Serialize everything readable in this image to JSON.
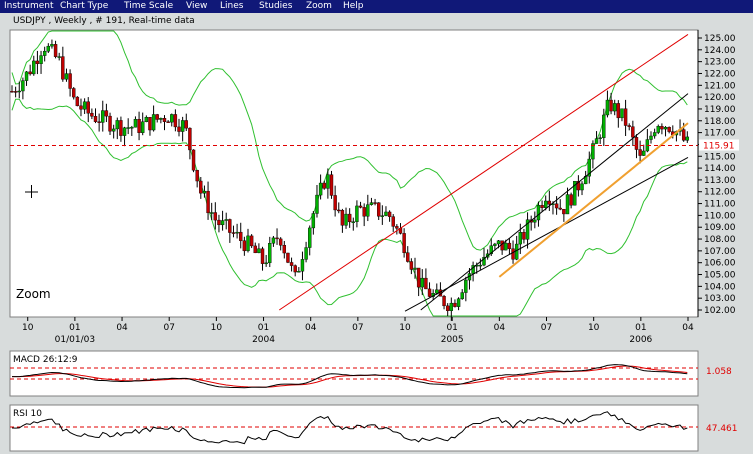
{
  "menu": {
    "items": [
      "Instrument",
      "Chart Type",
      "Time Scale",
      "View",
      "Lines",
      "Studies",
      "Zoom",
      "Help"
    ]
  },
  "main_chart": {
    "title": "USDJPY , Weekly , # 191, Real-time data",
    "zoom_label": "Zoom",
    "y_tick_labels": [
      "125.00",
      "124.00",
      "123.00",
      "122.00",
      "121.00",
      "120.00",
      "119.00",
      "118.00",
      "117.00",
      "116.00",
      "115.00",
      "114.00",
      "113.00",
      "112.00",
      "111.00",
      "110.00",
      "109.00",
      "108.00",
      "107.00",
      "106.00",
      "105.00",
      "104.00",
      "103.00",
      "102.00"
    ],
    "current_price_label": "115.91",
    "x_month_labels": [
      "10",
      "01",
      "04",
      "07",
      "10",
      "01",
      "04",
      "07",
      "10",
      "01",
      "04",
      "07",
      "10",
      "01",
      "04"
    ],
    "x_year_labels": [
      "01/01/03",
      "2004",
      "2005",
      "2006"
    ]
  },
  "macd_panel": {
    "title": "MACD 26:12:9",
    "value_label": "1.058"
  },
  "rsi_panel": {
    "title": "RSI 10",
    "value_label": "47.461"
  },
  "colors": {
    "menubar_bg": "#101878",
    "frame_bg": "#d8dcdc",
    "panel_bg": "#ffffff",
    "candle_up": "#00b000",
    "candle_down": "#c00000",
    "bollinger": "#30c030",
    "trendline_red": "#e00000",
    "trendline_black": "#000000",
    "trendline_orange": "#f0a030",
    "dashed_level": "#e00000"
  },
  "chart_data": {
    "type": "candlestick",
    "title": "USDJPY , Weekly , # 191, Real-time data",
    "timeframe": "Weekly",
    "x_range": [
      "2002-09",
      "2006-04"
    ],
    "ylim": [
      102.0,
      125.5
    ],
    "y_tick_step": 1.0,
    "current_price": 115.91,
    "price_path_monthly": [
      {
        "date": "2002-09",
        "close": 120.5
      },
      {
        "date": "2002-10",
        "close": 122.0
      },
      {
        "date": "2002-11",
        "close": 124.5
      },
      {
        "date": "2002-12",
        "close": 123.0
      },
      {
        "date": "2003-01",
        "close": 119.5
      },
      {
        "date": "2003-02",
        "close": 118.5
      },
      {
        "date": "2003-03",
        "close": 118.0
      },
      {
        "date": "2003-04",
        "close": 117.5
      },
      {
        "date": "2003-05",
        "close": 117.5
      },
      {
        "date": "2003-06",
        "close": 118.0
      },
      {
        "date": "2003-07",
        "close": 118.5
      },
      {
        "date": "2003-08",
        "close": 117.5
      },
      {
        "date": "2003-09",
        "close": 112.0
      },
      {
        "date": "2003-10",
        "close": 109.5
      },
      {
        "date": "2003-11",
        "close": 108.5
      },
      {
        "date": "2003-12",
        "close": 107.5
      },
      {
        "date": "2004-01",
        "close": 106.0
      },
      {
        "date": "2004-02",
        "close": 108.5
      },
      {
        "date": "2004-03",
        "close": 104.5
      },
      {
        "date": "2004-04",
        "close": 109.5
      },
      {
        "date": "2004-05",
        "close": 113.5
      },
      {
        "date": "2004-06",
        "close": 109.0
      },
      {
        "date": "2004-07",
        "close": 110.5
      },
      {
        "date": "2004-08",
        "close": 110.5
      },
      {
        "date": "2004-09",
        "close": 110.0
      },
      {
        "date": "2004-10",
        "close": 107.5
      },
      {
        "date": "2004-11",
        "close": 104.0
      },
      {
        "date": "2004-12",
        "close": 103.0
      },
      {
        "date": "2005-01",
        "close": 102.5
      },
      {
        "date": "2005-02",
        "close": 105.0
      },
      {
        "date": "2005-03",
        "close": 106.5
      },
      {
        "date": "2005-04",
        "close": 107.5
      },
      {
        "date": "2005-05",
        "close": 107.0
      },
      {
        "date": "2005-06",
        "close": 109.5
      },
      {
        "date": "2005-07",
        "close": 112.0
      },
      {
        "date": "2005-08",
        "close": 110.5
      },
      {
        "date": "2005-09",
        "close": 112.5
      },
      {
        "date": "2005-10",
        "close": 115.5
      },
      {
        "date": "2005-11",
        "close": 119.5
      },
      {
        "date": "2005-12",
        "close": 118.0
      },
      {
        "date": "2006-01",
        "close": 114.5
      },
      {
        "date": "2006-02",
        "close": 118.0
      },
      {
        "date": "2006-03",
        "close": 117.5
      },
      {
        "date": "2006-04",
        "close": 115.91
      }
    ],
    "overlays": [
      "Bollinger Bands",
      "trend lines",
      "dashed level at 115.91"
    ]
  }
}
